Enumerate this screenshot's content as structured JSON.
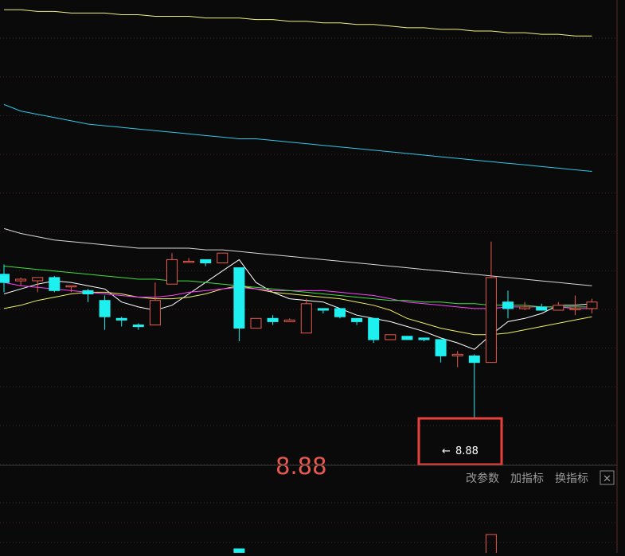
{
  "annotation": {
    "label": "8.88",
    "marker_label": "8.88"
  },
  "indicator_bar": {
    "modify_params": "改参数",
    "add_indicator": "加指标",
    "switch_indicator": "换指标",
    "close_symbol": "✕"
  },
  "colors": {
    "background": "#0a0a0a",
    "grid": "#4a2424",
    "up": "#e8594e",
    "down": "#1ef0f0",
    "ma5": "#ffffff",
    "ma10": "#f0f060",
    "ma20": "#ff40ff",
    "ma30": "#40e040",
    "ma60": "#d8d8d8",
    "ma120": "#30c8e8",
    "ma250": "#f0f080",
    "highlight": "#e8403c",
    "annotation_text": "#e8594e",
    "toolbar_text": "#9a9a9a"
  },
  "chart_data": {
    "type": "candlestick",
    "ylim": [
      8.6,
      11.45
    ],
    "highlight_low": 8.88,
    "candles": [
      {
        "o": 9.77,
        "h": 9.83,
        "l": 9.66,
        "c": 9.72
      },
      {
        "o": 9.73,
        "h": 9.75,
        "l": 9.7,
        "c": 9.74
      },
      {
        "o": 9.73,
        "h": 9.75,
        "l": 9.66,
        "c": 9.75
      },
      {
        "o": 9.75,
        "h": 9.76,
        "l": 9.66,
        "c": 9.67
      },
      {
        "o": 9.7,
        "h": 9.7,
        "l": 9.66,
        "c": 9.7
      },
      {
        "o": 9.67,
        "h": 9.68,
        "l": 9.6,
        "c": 9.65
      },
      {
        "o": 9.61,
        "h": 9.64,
        "l": 9.43,
        "c": 9.51
      },
      {
        "o": 9.5,
        "h": 9.51,
        "l": 9.45,
        "c": 9.49
      },
      {
        "o": 9.46,
        "h": 9.47,
        "l": 9.43,
        "c": 9.45
      },
      {
        "o": 9.46,
        "h": 9.72,
        "l": 9.46,
        "c": 9.61
      },
      {
        "o": 9.71,
        "h": 9.9,
        "l": 9.71,
        "c": 9.86
      },
      {
        "o": 9.85,
        "h": 9.87,
        "l": 9.85,
        "c": 9.85
      },
      {
        "o": 9.86,
        "h": 9.86,
        "l": 9.82,
        "c": 9.84
      },
      {
        "o": 9.84,
        "h": 9.9,
        "l": 9.84,
        "c": 9.9
      },
      {
        "o": 9.81,
        "h": 9.81,
        "l": 9.36,
        "c": 9.44
      },
      {
        "o": 9.44,
        "h": 9.5,
        "l": 9.44,
        "c": 9.5
      },
      {
        "o": 9.5,
        "h": 9.52,
        "l": 9.46,
        "c": 9.48
      },
      {
        "o": 9.48,
        "h": 9.5,
        "l": 9.48,
        "c": 9.49
      },
      {
        "o": 9.41,
        "h": 9.62,
        "l": 9.41,
        "c": 9.59
      },
      {
        "o": 9.56,
        "h": 9.56,
        "l": 9.53,
        "c": 9.55
      },
      {
        "o": 9.56,
        "h": 9.56,
        "l": 9.5,
        "c": 9.51
      },
      {
        "o": 9.5,
        "h": 9.5,
        "l": 9.46,
        "c": 9.48
      },
      {
        "o": 9.5,
        "h": 9.5,
        "l": 9.35,
        "c": 9.37
      },
      {
        "o": 9.37,
        "h": 9.4,
        "l": 9.37,
        "c": 9.4
      },
      {
        "o": 9.39,
        "h": 9.39,
        "l": 9.37,
        "c": 9.37
      },
      {
        "o": 9.38,
        "h": 9.38,
        "l": 9.36,
        "c": 9.37
      },
      {
        "o": 9.37,
        "h": 9.37,
        "l": 9.23,
        "c": 9.27
      },
      {
        "o": 9.27,
        "h": 9.3,
        "l": 9.2,
        "c": 9.28
      },
      {
        "o": 9.27,
        "h": 9.28,
        "l": 8.88,
        "c": 9.23
      },
      {
        "o": 9.23,
        "h": 9.97,
        "l": 9.23,
        "c": 9.75
      },
      {
        "o": 9.6,
        "h": 9.67,
        "l": 9.5,
        "c": 9.56
      },
      {
        "o": 9.56,
        "h": 9.6,
        "l": 9.55,
        "c": 9.57
      },
      {
        "o": 9.57,
        "h": 9.59,
        "l": 9.55,
        "c": 9.55
      },
      {
        "o": 9.55,
        "h": 9.6,
        "l": 9.55,
        "c": 9.58
      },
      {
        "o": 9.56,
        "h": 9.64,
        "l": 9.52,
        "c": 9.56
      },
      {
        "o": 9.56,
        "h": 9.62,
        "l": 9.53,
        "c": 9.6
      }
    ],
    "moving_averages": [
      {
        "name": "MA5",
        "values": [
          9.65,
          9.68,
          9.71,
          9.73,
          9.72,
          9.7,
          9.68,
          9.6,
          9.57,
          9.55,
          9.58,
          9.65,
          9.72,
          9.79,
          9.86,
          9.72,
          9.66,
          9.62,
          9.61,
          9.6,
          9.56,
          9.52,
          9.5,
          9.48,
          9.45,
          9.42,
          9.38,
          9.35,
          9.31,
          9.4,
          9.48,
          9.5,
          9.53,
          9.58,
          9.58,
          9.59
        ]
      },
      {
        "name": "MA10",
        "values": [
          9.56,
          9.58,
          9.61,
          9.63,
          9.65,
          9.66,
          9.66,
          9.65,
          9.63,
          9.62,
          9.62,
          9.63,
          9.65,
          9.68,
          9.7,
          9.68,
          9.66,
          9.65,
          9.64,
          9.63,
          9.62,
          9.6,
          9.58,
          9.55,
          9.5,
          9.47,
          9.44,
          9.42,
          9.4,
          9.4,
          9.41,
          9.43,
          9.45,
          9.47,
          9.49,
          9.51
        ]
      },
      {
        "name": "MA20",
        "values": [
          9.72,
          9.7,
          9.69,
          9.68,
          9.67,
          9.66,
          9.65,
          9.64,
          9.63,
          9.63,
          9.64,
          9.66,
          9.67,
          9.68,
          9.69,
          9.68,
          9.67,
          9.67,
          9.67,
          9.67,
          9.66,
          9.65,
          9.64,
          9.62,
          9.6,
          9.59,
          9.58,
          9.57,
          9.56,
          9.56,
          9.57,
          9.57,
          9.57,
          9.57,
          9.56,
          9.56
        ]
      },
      {
        "name": "MA30",
        "values": [
          9.82,
          9.81,
          9.8,
          9.79,
          9.78,
          9.77,
          9.76,
          9.75,
          9.74,
          9.74,
          9.73,
          9.73,
          9.72,
          9.71,
          9.7,
          9.69,
          9.68,
          9.67,
          9.66,
          9.65,
          9.64,
          9.63,
          9.62,
          9.61,
          9.61,
          9.6,
          9.6,
          9.59,
          9.59,
          9.58,
          9.58,
          9.58,
          9.57,
          9.57,
          9.57,
          9.57
        ]
      },
      {
        "name": "MA60",
        "values": [
          10.05,
          10.02,
          10.0,
          9.98,
          9.97,
          9.96,
          9.95,
          9.94,
          9.93,
          9.93,
          9.93,
          9.93,
          9.92,
          9.92,
          9.91,
          9.9,
          9.89,
          9.88,
          9.87,
          9.86,
          9.85,
          9.84,
          9.83,
          9.82,
          9.81,
          9.8,
          9.79,
          9.78,
          9.77,
          9.76,
          9.75,
          9.74,
          9.73,
          9.72,
          9.71,
          9.7
        ]
      },
      {
        "name": "MA120",
        "values": [
          10.81,
          10.77,
          10.75,
          10.73,
          10.71,
          10.69,
          10.68,
          10.67,
          10.66,
          10.65,
          10.64,
          10.63,
          10.62,
          10.61,
          10.6,
          10.6,
          10.59,
          10.58,
          10.57,
          10.56,
          10.55,
          10.54,
          10.53,
          10.52,
          10.51,
          10.5,
          10.49,
          10.48,
          10.47,
          10.46,
          10.45,
          10.44,
          10.43,
          10.42,
          10.41,
          10.4
        ]
      },
      {
        "name": "MA250",
        "values": [
          11.39,
          11.39,
          11.38,
          11.38,
          11.37,
          11.37,
          11.37,
          11.36,
          11.36,
          11.35,
          11.35,
          11.35,
          11.34,
          11.34,
          11.34,
          11.33,
          11.33,
          11.32,
          11.32,
          11.31,
          11.31,
          11.3,
          11.3,
          11.29,
          11.28,
          11.28,
          11.27,
          11.27,
          11.26,
          11.26,
          11.25,
          11.25,
          11.24,
          11.24,
          11.23,
          11.23
        ]
      }
    ],
    "lower_pane_volume_up_indices": [
      29
    ],
    "lower_pane_volume_down_indices": [
      14
    ]
  }
}
